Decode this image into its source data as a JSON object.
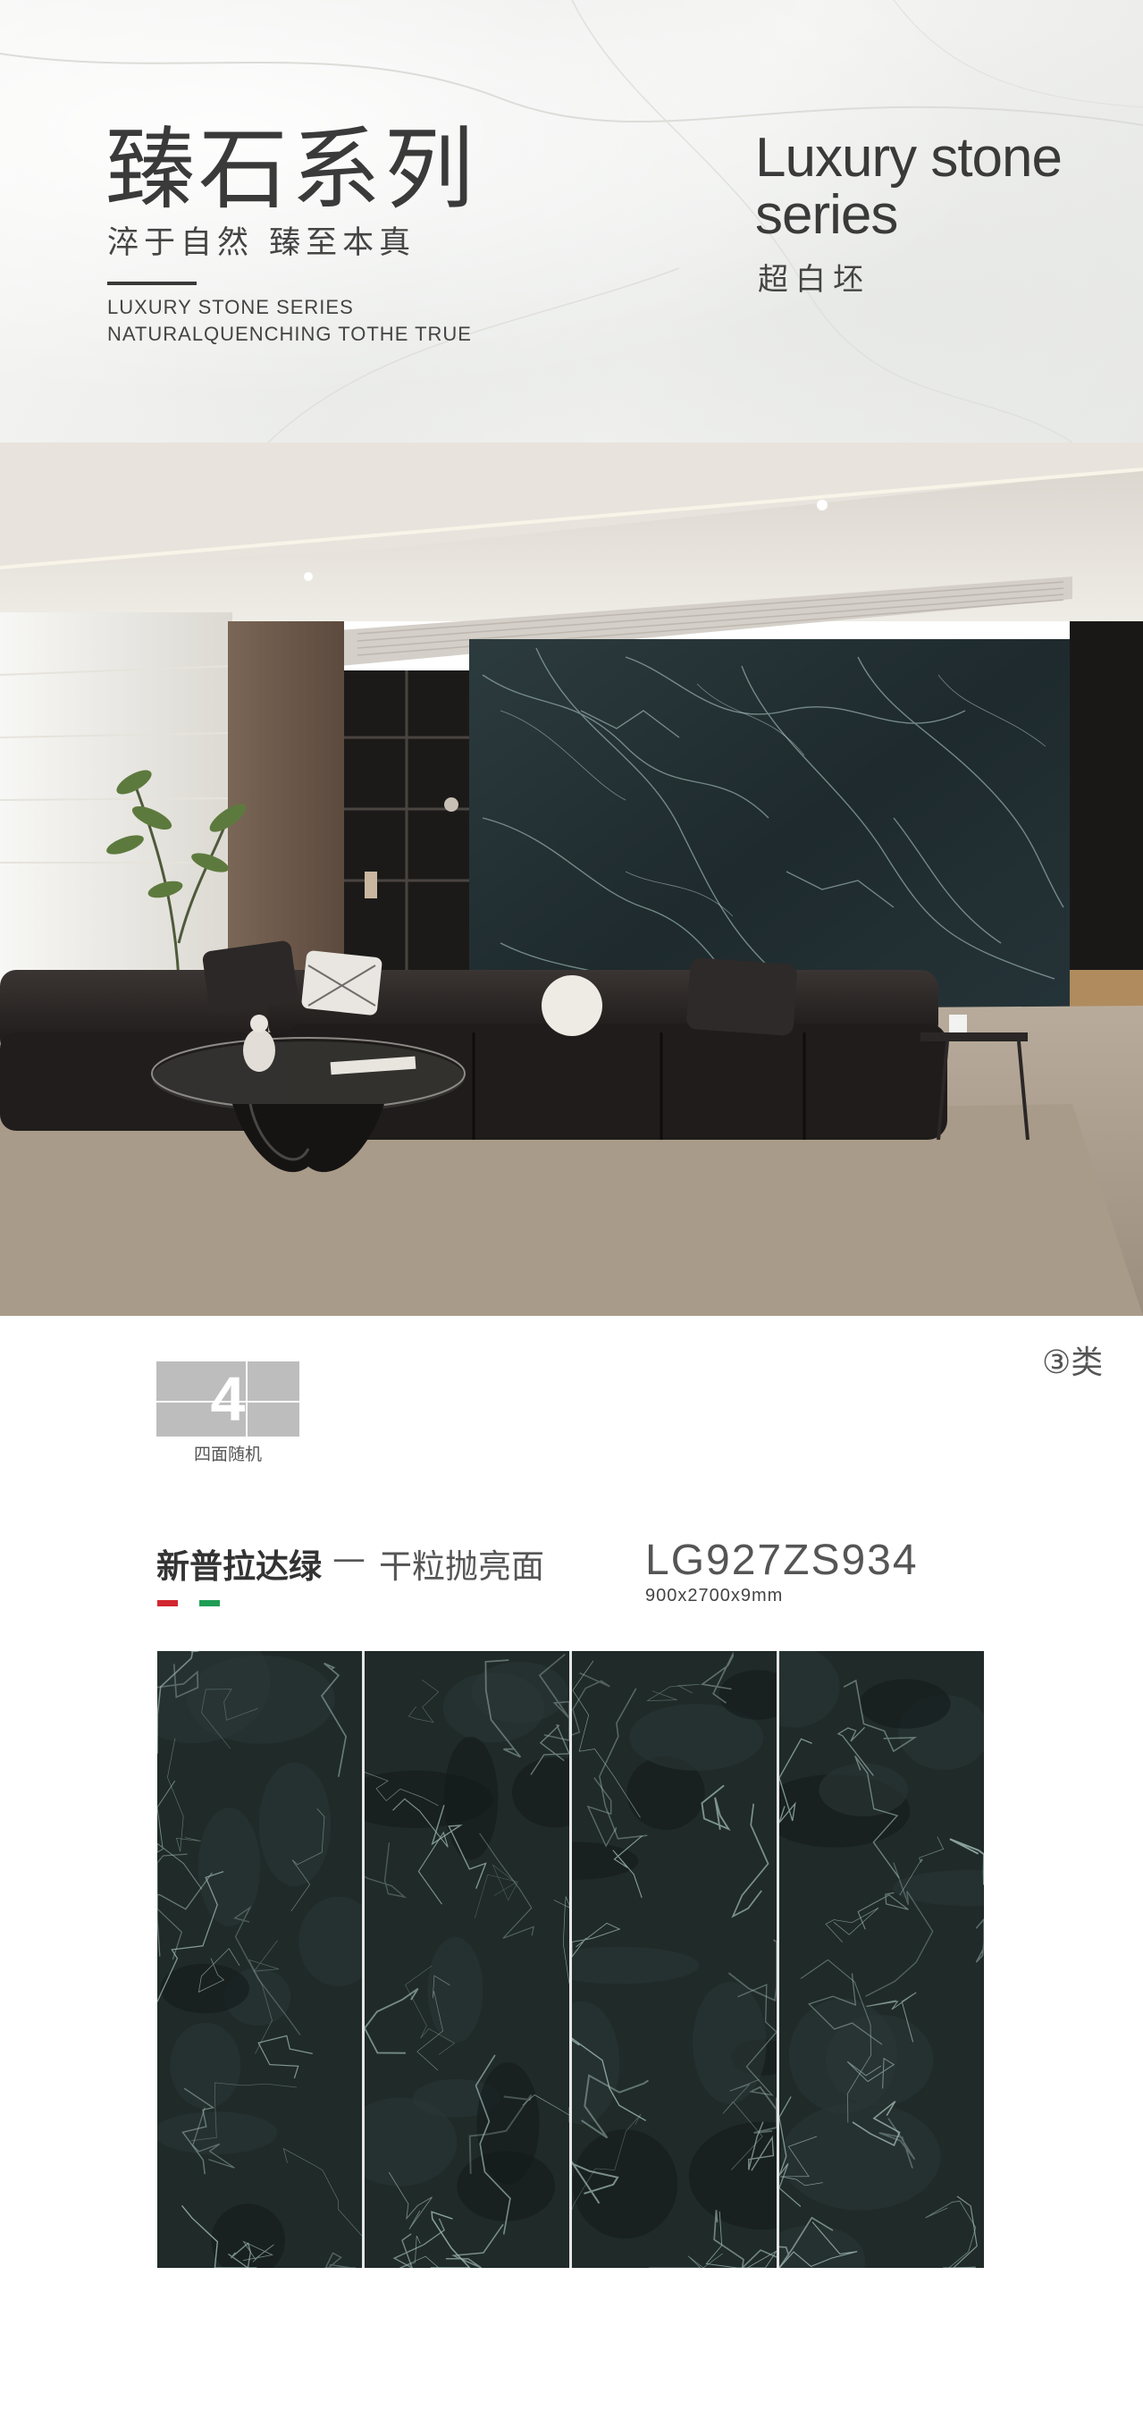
{
  "header": {
    "title_cn": "臻石系列",
    "slogan": "淬于自然  臻至本真",
    "en_line1": "LUXURY STONE SERIES",
    "en_line2": "NATURALQUENCHING TOTHE TRUE",
    "series_title": "Luxury stone series",
    "series_sub": "超白坯"
  },
  "scene": {
    "alt": "living room with dark green marble feature wall"
  },
  "badge": {
    "number": "4",
    "label": "四面随机"
  },
  "category_tag": "③类",
  "product": {
    "name": "新普拉达绿",
    "dash": "—",
    "finish": "干粒抛亮面",
    "code": "LG927ZS934",
    "size": "900x2700x9mm",
    "flag_colors": [
      "#d22630",
      "#ffffff",
      "#1f9d55"
    ]
  },
  "tiles": {
    "count": 4,
    "base_color": "#1f2a29",
    "vein_color": "#9fb8b2"
  }
}
